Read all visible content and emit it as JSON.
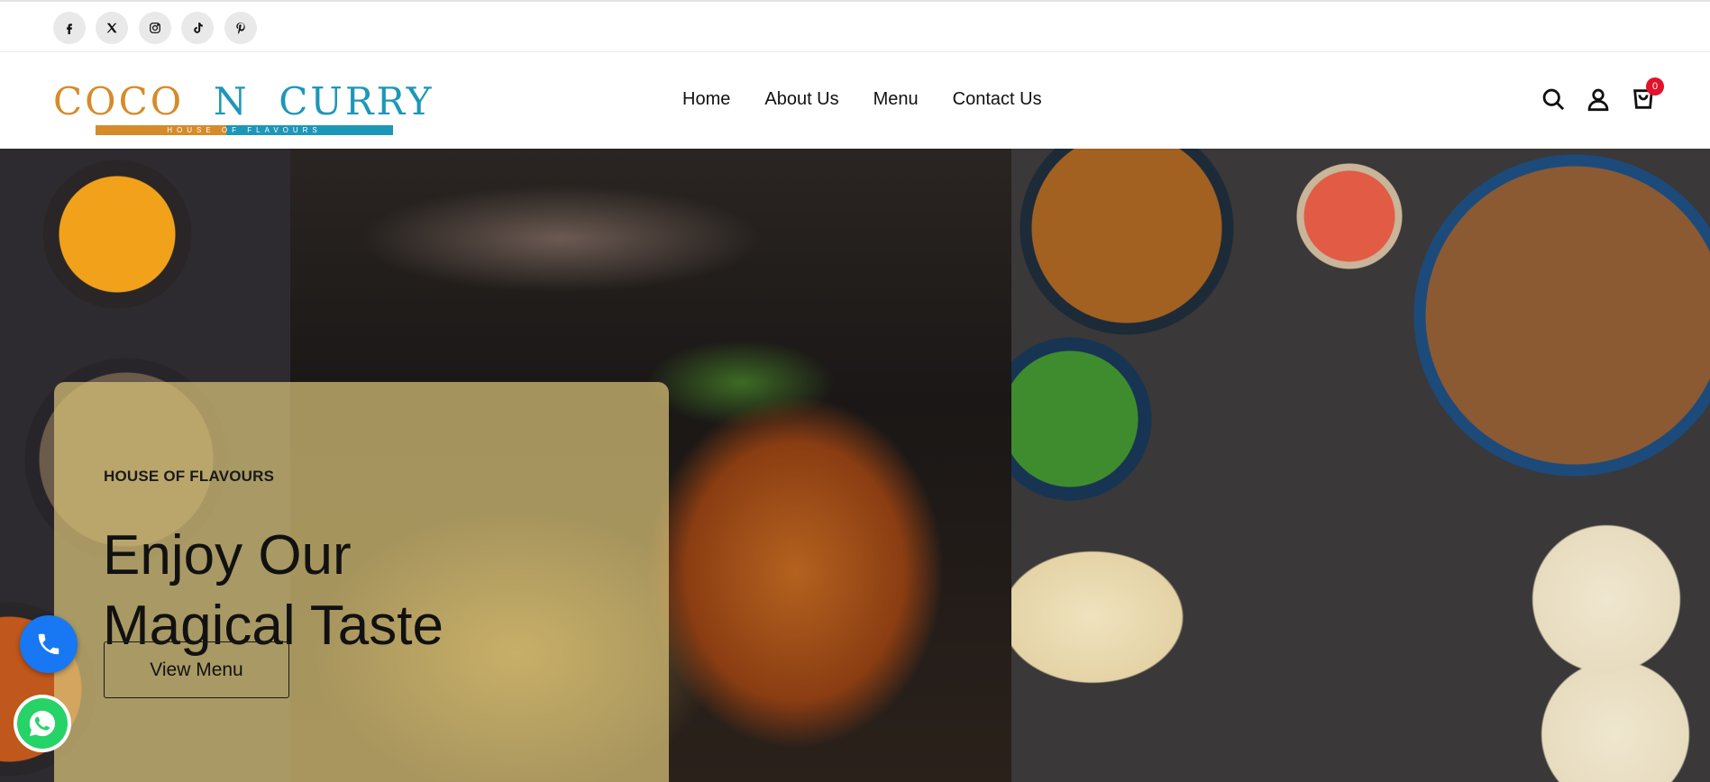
{
  "social": [
    {
      "name": "facebook-icon",
      "label": "f"
    },
    {
      "name": "x-twitter-icon",
      "label": "X"
    },
    {
      "name": "instagram-icon",
      "label": "ig"
    },
    {
      "name": "tiktok-icon",
      "label": "tt"
    },
    {
      "name": "pinterest-icon",
      "label": "p"
    }
  ],
  "brand": {
    "word1": "COCO",
    "word2": "N",
    "word3": "CURRY",
    "tagline": "HOUSE OF FLAVOURS",
    "colors": {
      "orange": "#d68b2a",
      "teal": "#1d97b8"
    }
  },
  "nav": {
    "items": [
      "Home",
      "About Us",
      "Menu",
      "Contact Us"
    ]
  },
  "header_icons": {
    "search": "search-icon",
    "account": "user-icon",
    "cart": "cart-icon",
    "cart_count": "0"
  },
  "hero": {
    "eyebrow": "HOUSE OF FLAVOURS",
    "headline_line1": "Enjoy Our",
    "headline_line2": "Magical Taste",
    "button_label": "View Menu"
  },
  "floating": {
    "call": "phone-icon",
    "whatsapp": "whatsapp-icon"
  }
}
